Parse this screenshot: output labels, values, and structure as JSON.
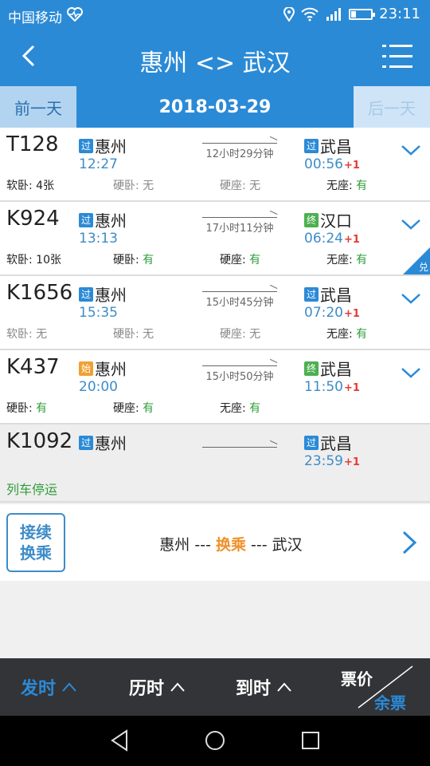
{
  "status": {
    "carrier": "中国移动",
    "time": "23:11"
  },
  "header": {
    "title": "惠州 <> 武汉"
  },
  "date_bar": {
    "prev": "前一天",
    "date": "2018-03-29",
    "next": "后一天"
  },
  "trains": [
    {
      "no": "T128",
      "dep_tag": "过",
      "dep_station": "惠州",
      "dep_time": "12:27",
      "duration": "12小时29分钟",
      "arr_tag": "过",
      "arr_station": "武昌",
      "arr_time": "00:56",
      "arr_plus": "+1",
      "seats": [
        {
          "label": "软卧:",
          "value": "4张"
        },
        {
          "label": "硬卧:",
          "value": "无"
        },
        {
          "label": "硬座:",
          "value": "无"
        },
        {
          "label": "无座:",
          "value": "有"
        }
      ]
    },
    {
      "no": "K924",
      "dep_tag": "过",
      "dep_station": "惠州",
      "dep_time": "13:13",
      "duration": "17小时11分钟",
      "arr_tag": "终",
      "arr_station": "汉口",
      "arr_time": "06:24",
      "arr_plus": "+1",
      "corner": "兑",
      "seats": [
        {
          "label": "软卧:",
          "value": "10张"
        },
        {
          "label": "硬卧:",
          "value": "有"
        },
        {
          "label": "硬座:",
          "value": "有"
        },
        {
          "label": "无座:",
          "value": "有"
        }
      ]
    },
    {
      "no": "K1656",
      "dep_tag": "过",
      "dep_station": "惠州",
      "dep_time": "15:35",
      "duration": "15小时45分钟",
      "arr_tag": "过",
      "arr_station": "武昌",
      "arr_time": "07:20",
      "arr_plus": "+1",
      "seats": [
        {
          "label": "软卧:",
          "value": "无"
        },
        {
          "label": "硬卧:",
          "value": "无"
        },
        {
          "label": "硬座:",
          "value": "无"
        },
        {
          "label": "无座:",
          "value": "有"
        }
      ]
    },
    {
      "no": "K437",
      "dep_tag": "始",
      "dep_station": "惠州",
      "dep_time": "20:00",
      "duration": "15小时50分钟",
      "arr_tag": "终",
      "arr_station": "武昌",
      "arr_time": "11:50",
      "arr_plus": "+1",
      "seats": [
        {
          "label": "硬卧:",
          "value": "有"
        },
        {
          "label": "硬座:",
          "value": "有"
        },
        {
          "label": "无座:",
          "value": "有"
        }
      ]
    },
    {
      "no": "K1092",
      "dep_tag": "过",
      "dep_station": "惠州",
      "arr_tag": "过",
      "arr_station": "武昌",
      "arr_time": "23:59",
      "arr_plus": "+1",
      "suspended": "列车停运"
    }
  ],
  "transfer": {
    "badge_line1": "接续",
    "badge_line2": "换乘",
    "from": "惠州",
    "sep1": "---",
    "mid": "换乘",
    "sep2": "---",
    "to": "武汉"
  },
  "sort_bar": {
    "depart": "发时",
    "duration": "历时",
    "arrive": "到时",
    "price": "票价",
    "remain": "余票"
  },
  "colors": {
    "accent": "#2b8ad6",
    "available": "#2e9d3a",
    "highlight": "#f0902a",
    "overnight": "#e53935"
  }
}
